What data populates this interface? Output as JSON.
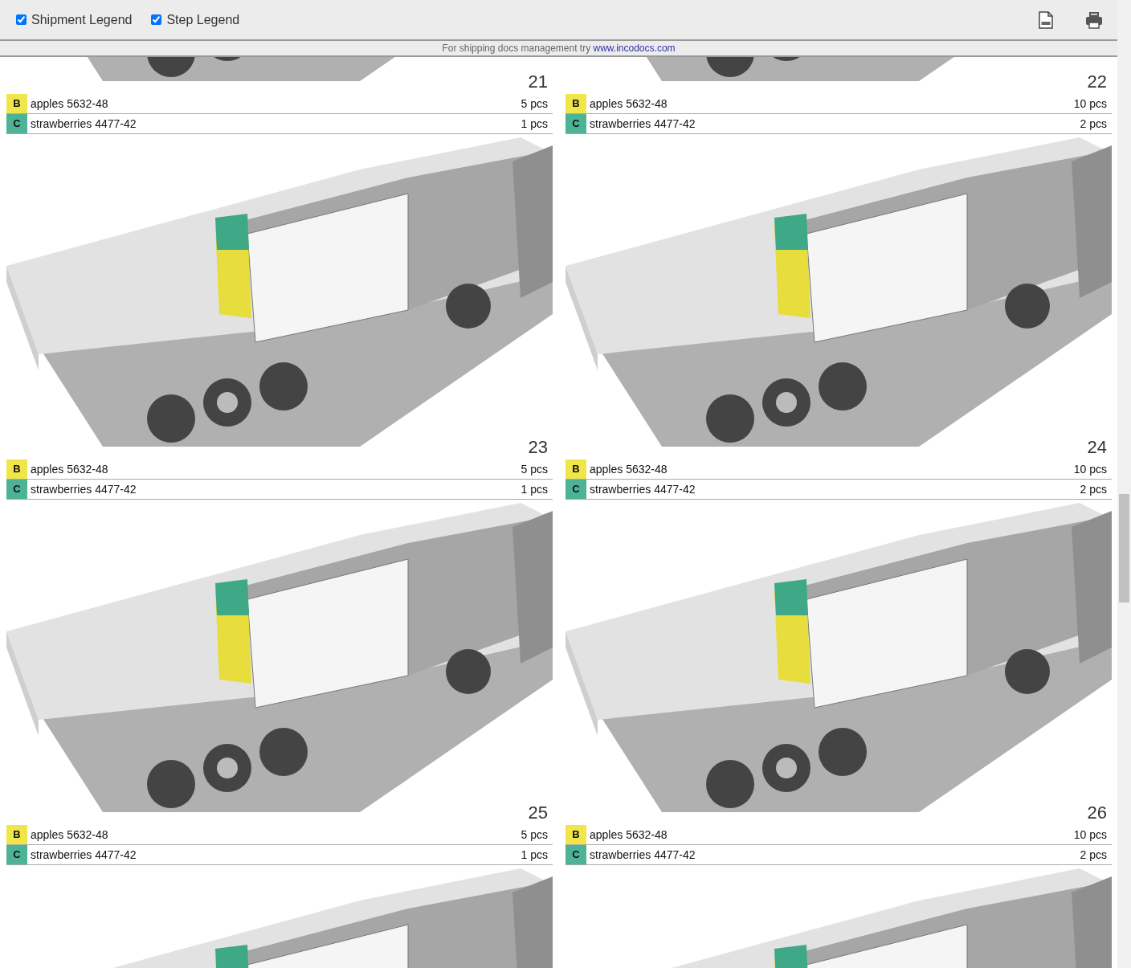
{
  "toolbar": {
    "checkboxes": [
      {
        "label": "Shipment Legend",
        "checked": true
      },
      {
        "label": "Step Legend",
        "checked": true
      }
    ]
  },
  "notice": {
    "text": "For shipping docs management try",
    "link": "www.incodocs.com"
  },
  "steps": [
    {
      "view": {
        "kind": "picture"
      },
      "number": "21",
      "items": [
        {
          "code": "B",
          "name": "apples 5632-48",
          "qty": "5 pcs",
          "color": "#f0e64a"
        },
        {
          "code": "C",
          "name": "strawberries 4477-42",
          "qty": "1 pcs",
          "color": "#4cb396"
        }
      ]
    },
    {
      "view": {
        "kind": "picture"
      },
      "number": "22",
      "items": [
        {
          "code": "B",
          "name": "apples 5632-48",
          "qty": "10 pcs",
          "color": "#f0e64a"
        },
        {
          "code": "C",
          "name": "strawberries 4477-42",
          "qty": "2 pcs",
          "color": "#4cb396"
        }
      ]
    },
    {
      "view": {
        "kind": "picture"
      },
      "number": "23",
      "items": [
        {
          "code": "B",
          "name": "apples 5632-48",
          "qty": "5 pcs",
          "color": "#f0e64a"
        },
        {
          "code": "C",
          "name": "strawberries 4477-42",
          "qty": "1 pcs",
          "color": "#4cb396"
        }
      ]
    },
    {
      "view": {
        "kind": "picture"
      },
      "number": "24",
      "items": [
        {
          "code": "B",
          "name": "apples 5632-48",
          "qty": "10 pcs",
          "color": "#f0e64a"
        },
        {
          "code": "C",
          "name": "strawberries 4477-42",
          "qty": "2 pcs",
          "color": "#4cb396"
        }
      ]
    },
    {
      "view": {
        "kind": "picture"
      },
      "number": "25",
      "items": [
        {
          "code": "B",
          "name": "apples 5632-48",
          "qty": "5 pcs",
          "color": "#f0e64a"
        },
        {
          "code": "C",
          "name": "strawberries 4477-42",
          "qty": "1 pcs",
          "color": "#4cb396"
        }
      ]
    },
    {
      "view": {
        "kind": "picture"
      },
      "number": "26",
      "items": [
        {
          "code": "B",
          "name": "apples 5632-48",
          "qty": "10 pcs",
          "color": "#f0e64a"
        },
        {
          "code": "C",
          "name": "strawberries 4477-42",
          "qty": "2 pcs",
          "color": "#4cb396"
        }
      ]
    },
    {
      "view": {
        "kind": "picture"
      }
    },
    {
      "view": {
        "kind": "picture"
      }
    }
  ]
}
